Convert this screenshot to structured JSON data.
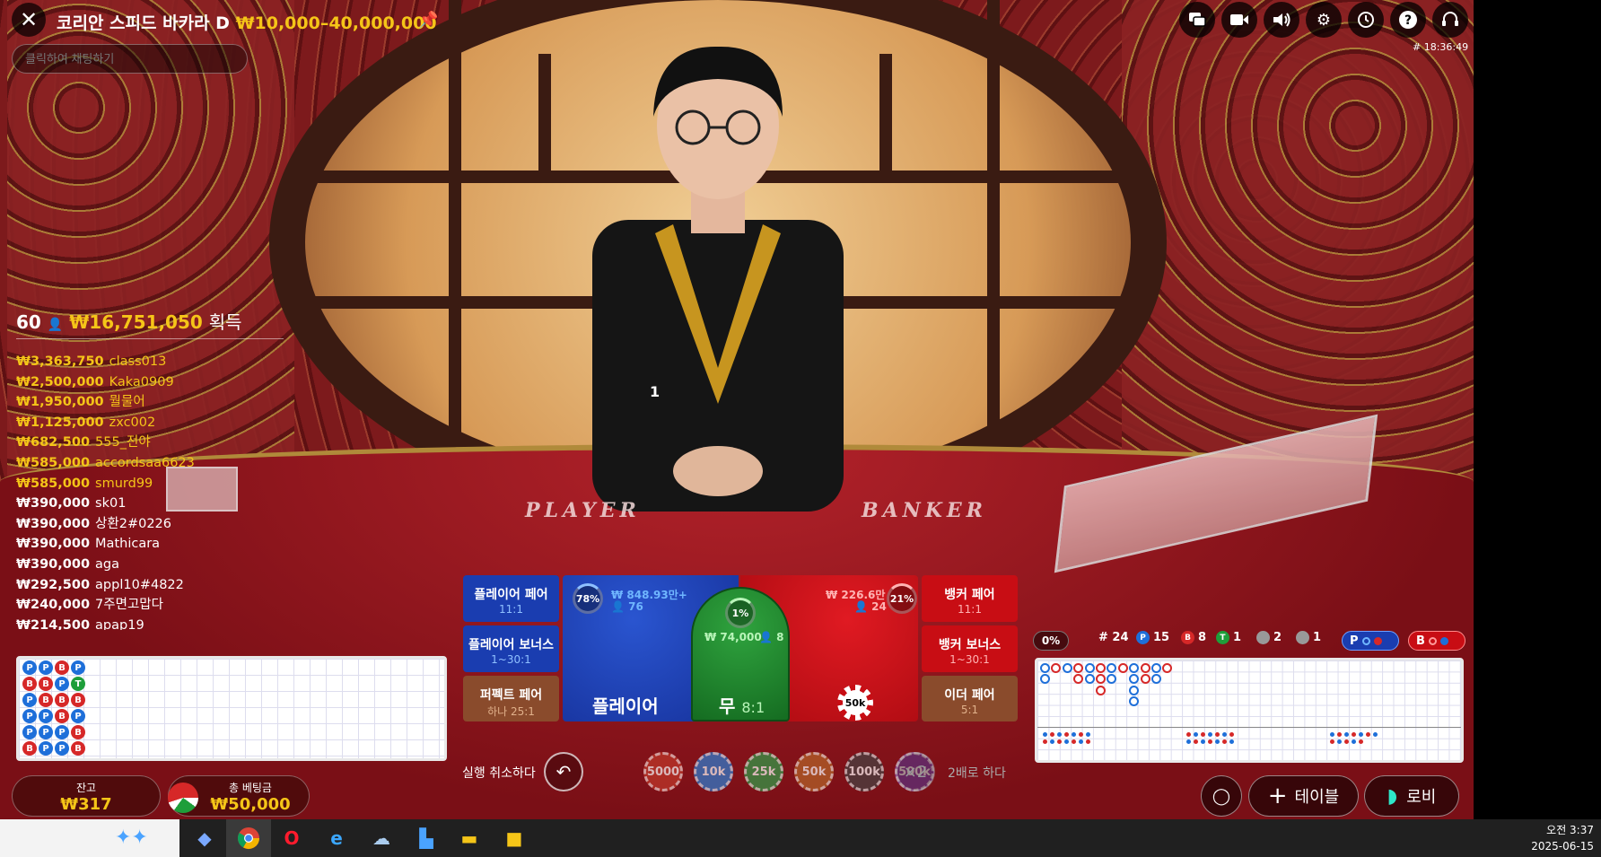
{
  "title": {
    "name": "코리안 스피드 바카라 D",
    "limits": "₩10,000–40,000,000"
  },
  "chat": {
    "placeholder": "클릭하여 채팅하기"
  },
  "top_icons": [
    "chat-icon",
    "video-icon",
    "speaker-icon",
    "settings-icon",
    "history-icon",
    "help-icon",
    "headset-icon"
  ],
  "clock": "# 18:36:49",
  "scene": {
    "player_text": "PLAYER",
    "banker_text": "BANKER",
    "round_marker": "1"
  },
  "winners": {
    "count": "60",
    "total": "₩16,751,050",
    "label": "획득",
    "rows": [
      {
        "amount": "₩3,363,750",
        "name": "class013",
        "gold": true
      },
      {
        "amount": "₩2,500,000",
        "name": "Kaka0909",
        "gold": true
      },
      {
        "amount": "₩1,950,000",
        "name": "뭘물어",
        "gold": true
      },
      {
        "amount": "₩1,125,000",
        "name": "zxc002",
        "gold": true
      },
      {
        "amount": "₩682,500",
        "name": "555_전야",
        "gold": true
      },
      {
        "amount": "₩585,000",
        "name": "accordsaa6623",
        "gold": true
      },
      {
        "amount": "₩585,000",
        "name": "smurd99",
        "gold": true
      },
      {
        "amount": "₩390,000",
        "name": "sk01",
        "gold": false
      },
      {
        "amount": "₩390,000",
        "name": "상환2#0226",
        "gold": false
      },
      {
        "amount": "₩390,000",
        "name": "Mathicara",
        "gold": false
      },
      {
        "amount": "₩390,000",
        "name": "aga",
        "gold": false
      },
      {
        "amount": "₩292,500",
        "name": "appl10#4822",
        "gold": false
      },
      {
        "amount": "₩240,000",
        "name": "7주면고맙다",
        "gold": false
      },
      {
        "amount": "₩214,500",
        "name": "apap19",
        "gold": false
      }
    ]
  },
  "bead_road": [
    [
      "P",
      "P",
      "B",
      "P"
    ],
    [
      "B",
      "B",
      "P",
      "T"
    ],
    [
      "P",
      "B",
      "B",
      "B"
    ],
    [
      "P",
      "P",
      "B",
      "P"
    ],
    [
      "P",
      "P",
      "P",
      "B"
    ],
    [
      "B",
      "P",
      "P",
      "B"
    ]
  ],
  "balance": {
    "label": "잔고",
    "value": "₩317"
  },
  "total_bet": {
    "label": "총 베팅금",
    "value": "₩50,000"
  },
  "bets": {
    "player_pair": {
      "name": "플레이어 페어",
      "odds": "11:1"
    },
    "player_bonus": {
      "name": "플레이어 보너스",
      "odds": "1~30:1"
    },
    "perfect_pair": {
      "name": "퍼펙트 페어",
      "odds": "하나 25:1"
    },
    "banker_pair": {
      "name": "뱅커 페어",
      "odds": "11:1"
    },
    "banker_bonus": {
      "name": "뱅커 보너스",
      "odds": "1~30:1"
    },
    "either_pair": {
      "name": "이더 페어",
      "odds": "5:1"
    },
    "player": {
      "name": "플레이어",
      "pct": "78%",
      "amount": "₩ 848.93만+",
      "players": "76"
    },
    "tie": {
      "name": "무",
      "odds": "8:1",
      "pct": "1%",
      "amount": "₩ 74,000",
      "players": "8"
    },
    "banker": {
      "pct": "21%",
      "amount": "₩ 226.6만",
      "players": "24",
      "chip": "50k"
    }
  },
  "chips": {
    "undo_label": "실행 취소하다",
    "values": [
      {
        "label": "5000",
        "color": "#c0392b"
      },
      {
        "label": "10k",
        "color": "#2a7fd4"
      },
      {
        "label": "25k",
        "color": "#2e9e4a"
      },
      {
        "label": "50k",
        "color": "#b5652a"
      },
      {
        "label": "100k",
        "color": "#444444"
      },
      {
        "label": "500k",
        "color": "#8e44ad"
      }
    ],
    "double_symbol": "×2",
    "double_label": "2배로 하다"
  },
  "scoreboard": {
    "progress": "0%",
    "rounds": "# 24",
    "player": "15",
    "banker": "8",
    "tie": "1",
    "player_pair": "2",
    "banker_pair": "1",
    "p_badge": "P",
    "b_badge": "B"
  },
  "buttons": {
    "table": "테이블",
    "lobby": "로비"
  },
  "taskbar": {
    "time": "오전 3:37",
    "date": "2025-06-15"
  }
}
